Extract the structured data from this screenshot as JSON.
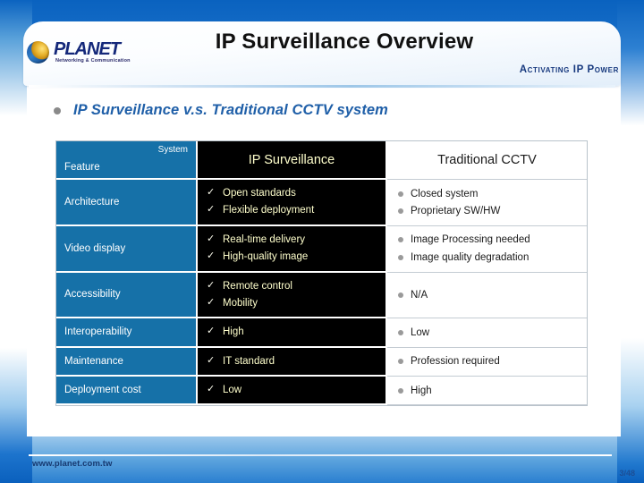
{
  "header": {
    "title": "IP Surveillance Overview",
    "logo_wordmark": "PLANET",
    "logo_tagline": "Networking & Communication",
    "activating_tagline": "Activating IP Power"
  },
  "subtitle": {
    "text": "IP Surveillance v.s. Traditional CCTV system"
  },
  "table": {
    "header": {
      "system_label": "System",
      "feature_label": "Feature",
      "col_ip": "IP Surveillance",
      "col_cctv": "Traditional CCTV"
    },
    "rows": [
      {
        "feature": "Architecture",
        "ip": [
          "Open standards",
          "Flexible deployment"
        ],
        "cctv": [
          "Closed system",
          "Proprietary SW/HW"
        ]
      },
      {
        "feature": "Video display",
        "ip": [
          "Real-time delivery",
          "High-quality image"
        ],
        "cctv": [
          "Image Processing needed",
          "Image quality degradation"
        ]
      },
      {
        "feature": "Accessibility",
        "ip": [
          "Remote control",
          "Mobility"
        ],
        "cctv": [
          "N/A"
        ]
      },
      {
        "feature": "Interoperability",
        "ip": [
          "High"
        ],
        "cctv": [
          "Low"
        ]
      },
      {
        "feature": "Maintenance",
        "ip": [
          "IT standard"
        ],
        "cctv": [
          "Profession required"
        ]
      },
      {
        "feature": "Deployment cost",
        "ip": [
          "Low"
        ],
        "cctv": [
          "High"
        ]
      }
    ],
    "check_glyph": "✓",
    "bullet_glyph": "●"
  },
  "footer": {
    "url": "www.planet.com.tw",
    "page_number": "3/48"
  },
  "colors": {
    "feature_blue": "#1671a8",
    "ip_bg": "#000000",
    "ip_text": "#ffffcc",
    "subtitle_blue": "#1f5fa8",
    "brand_navy": "#14287a"
  }
}
